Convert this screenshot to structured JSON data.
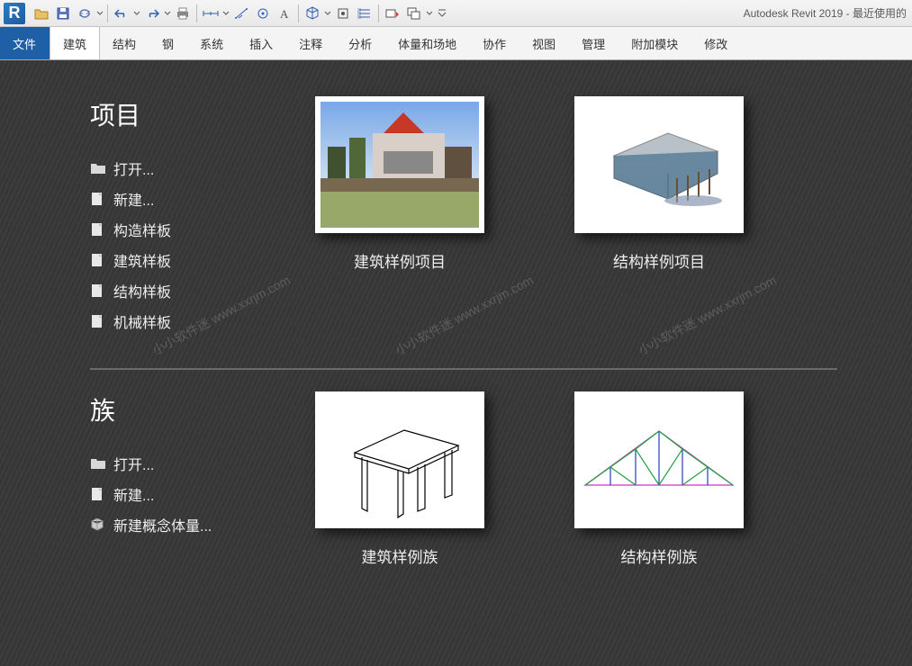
{
  "app": {
    "title": "Autodesk Revit 2019 - 最近使用的"
  },
  "ribbon": {
    "file": "文件",
    "tabs": [
      "建筑",
      "结构",
      "钢",
      "系统",
      "插入",
      "注释",
      "分析",
      "体量和场地",
      "协作",
      "视图",
      "管理",
      "附加模块",
      "修改"
    ]
  },
  "sections": {
    "project": {
      "title": "项目",
      "items": [
        {
          "icon": "folder",
          "label": "打开..."
        },
        {
          "icon": "doc",
          "label": "新建..."
        },
        {
          "icon": "doc",
          "label": "构造样板"
        },
        {
          "icon": "doc",
          "label": "建筑样板"
        },
        {
          "icon": "doc",
          "label": "结构样板"
        },
        {
          "icon": "doc",
          "label": "机械样板"
        }
      ],
      "tiles": [
        {
          "label": "建筑样例项目"
        },
        {
          "label": "结构样例项目"
        }
      ]
    },
    "family": {
      "title": "族",
      "items": [
        {
          "icon": "folder",
          "label": "打开..."
        },
        {
          "icon": "doc",
          "label": "新建..."
        },
        {
          "icon": "cube",
          "label": "新建概念体量..."
        }
      ],
      "tiles": [
        {
          "label": "建筑样例族"
        },
        {
          "label": "结构样例族"
        }
      ]
    }
  },
  "watermarks": [
    "小小软件迷  www.xxrjm.com",
    "小小软件迷  www.xxrjm.com",
    "小小软件迷  www.xxrjm.com"
  ]
}
